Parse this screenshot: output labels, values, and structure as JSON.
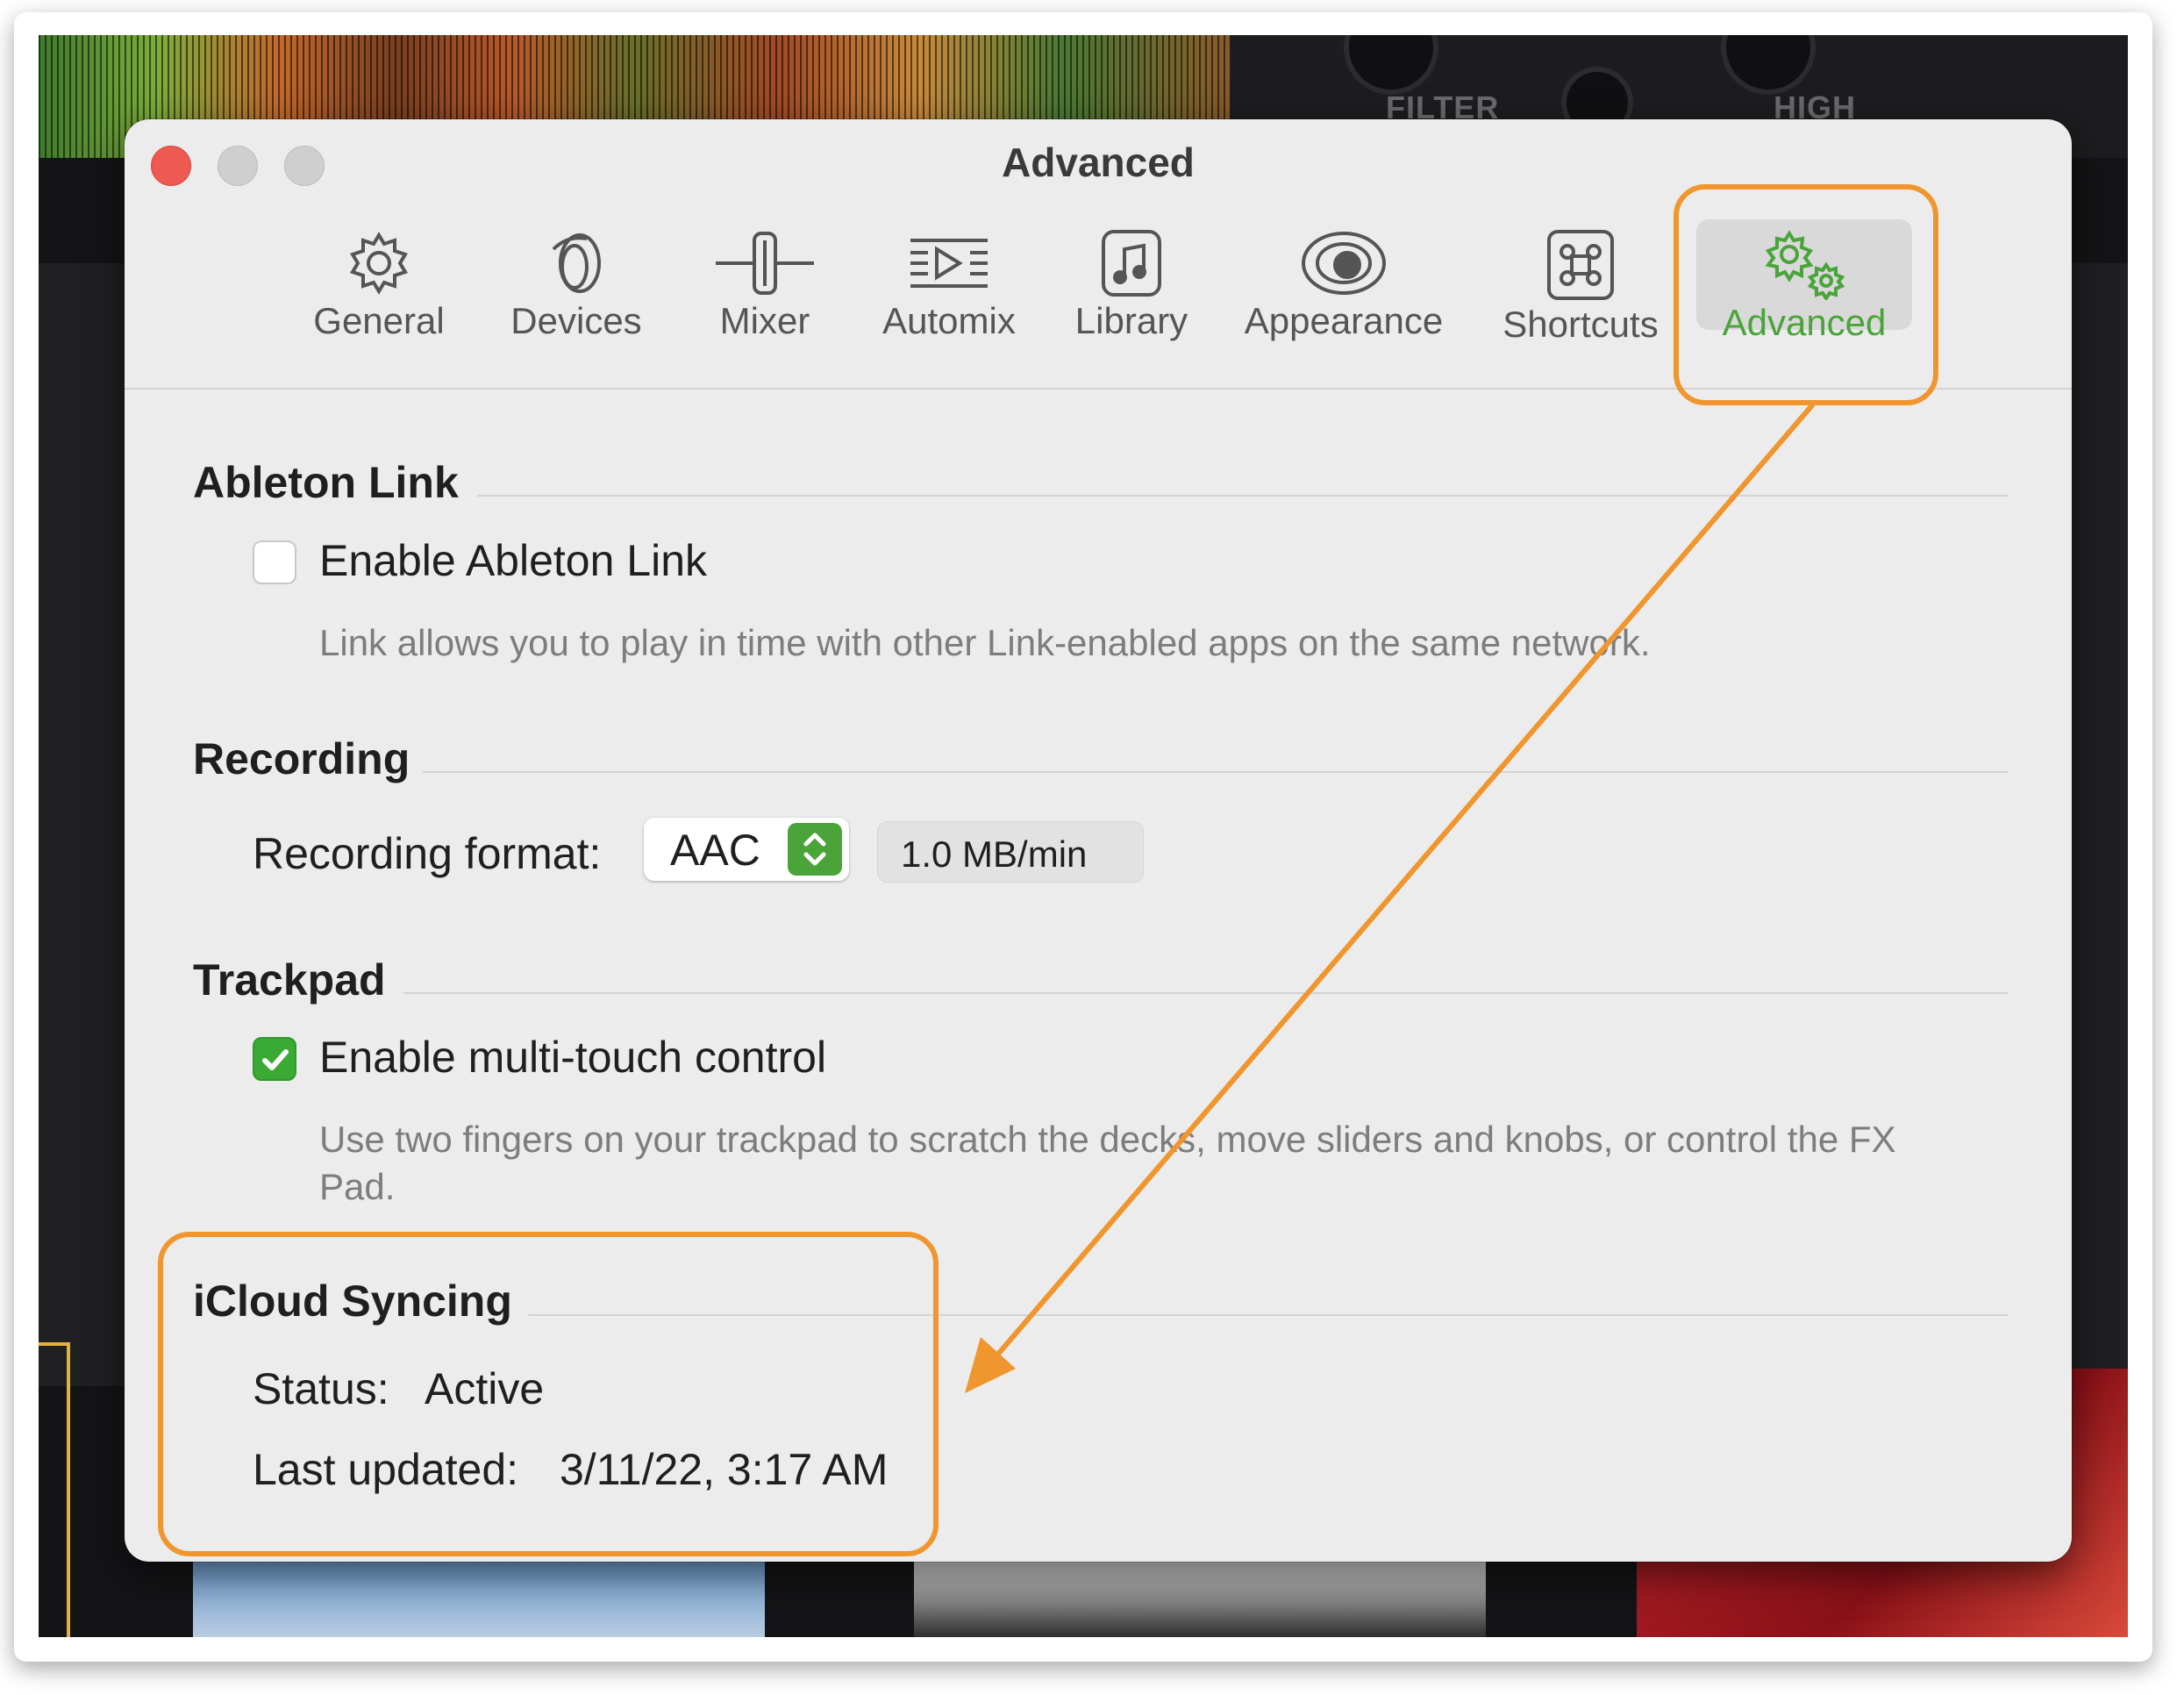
{
  "background_app": {
    "knob_labels": [
      "FILTER",
      "HIGH"
    ]
  },
  "window": {
    "title": "Advanced",
    "tabs": [
      {
        "label": "General",
        "icon": "gear-icon"
      },
      {
        "label": "Devices",
        "icon": "devices-icon"
      },
      {
        "label": "Mixer",
        "icon": "mixer-fader-icon"
      },
      {
        "label": "Automix",
        "icon": "automix-icon"
      },
      {
        "label": "Library",
        "icon": "music-note-icon"
      },
      {
        "label": "Appearance",
        "icon": "eye-icon"
      },
      {
        "label": "Shortcuts",
        "icon": "command-key-icon"
      },
      {
        "label": "Advanced",
        "icon": "gears-icon",
        "active": true
      }
    ]
  },
  "sections": {
    "ableton": {
      "title": "Ableton Link",
      "checkbox_label": "Enable Ableton Link",
      "checked": false,
      "help": "Link allows you to play in time with other Link-enabled apps on the same network."
    },
    "recording": {
      "title": "Recording",
      "format_label": "Recording format:",
      "format_value": "AAC",
      "rate": "1.0 MB/min"
    },
    "trackpad": {
      "title": "Trackpad",
      "checkbox_label": "Enable multi-touch control",
      "checked": true,
      "help": "Use two fingers on your trackpad to scratch the decks, move sliders and knobs, or control the FX Pad."
    },
    "icloud": {
      "title": "iCloud Syncing",
      "status_label": "Status:",
      "status_value": "Active",
      "updated_label": "Last updated:",
      "updated_value": "3/11/22, 3:17 AM"
    }
  },
  "colors": {
    "accent_green": "#4aa43a",
    "annotation_orange": "#f0962e",
    "close_red": "#ee5a51"
  }
}
